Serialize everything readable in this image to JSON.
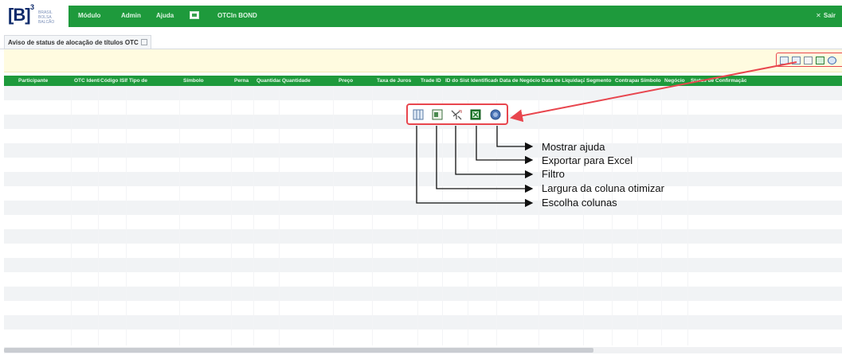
{
  "header": {
    "logo_letter": "[B]",
    "logo_sup": "3",
    "logo_subtext": "BRASIL BOLSA BALCÃO",
    "menu": [
      "Módulo",
      "Admin",
      "Ajuda"
    ],
    "product": "OTCIn BOND",
    "logout": "Sair"
  },
  "tab": {
    "title": "Aviso de status de alocação de títulos OTC"
  },
  "grid": {
    "columns": [
      "Participante",
      "OTC Identificador",
      "Código ISIN",
      "Tipo de",
      "Símbolo",
      "Perna",
      "Quantidade",
      "Quantidade",
      "Preço",
      "Taxa de Juros",
      "Trade ID",
      "ID do Sistema",
      "Identificador",
      "Data de Negócio",
      "Data de Liquidação",
      "Segmento",
      "Contraparte",
      "Símbolo",
      "Negócio",
      "Status de Confirmação"
    ]
  },
  "callout": {
    "labels": {
      "help": "Mostrar ajuda",
      "excel": "Exportar para Excel",
      "filter": "Filtro",
      "width": "Largura da coluna otimizar",
      "columns": "Escolha colunas"
    },
    "icons": [
      "choose-columns-icon",
      "optimize-width-icon",
      "filter-icon",
      "export-excel-icon",
      "help-icon"
    ],
    "accent_color": "#e8464e"
  },
  "colors": {
    "brand_green": "#1e9a3c",
    "toolbar_yellow": "#fffbe0"
  }
}
